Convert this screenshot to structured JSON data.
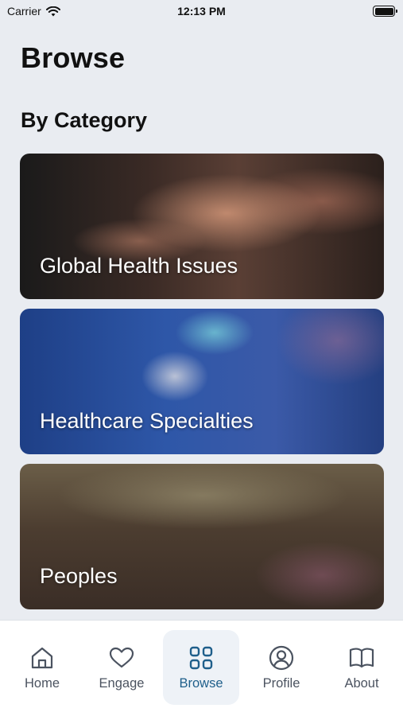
{
  "status_bar": {
    "carrier": "Carrier",
    "time": "12:13 PM"
  },
  "page_title": "Browse",
  "section_title": "By Category",
  "categories": [
    {
      "label": "Global Health Issues"
    },
    {
      "label": "Healthcare Specialties"
    },
    {
      "label": "Peoples"
    }
  ],
  "tab_bar": {
    "tabs": [
      {
        "label": "Home",
        "icon": "house-icon",
        "active": false
      },
      {
        "label": "Engage",
        "icon": "heart-icon",
        "active": false
      },
      {
        "label": "Browse",
        "icon": "grid-icon",
        "active": true
      },
      {
        "label": "Profile",
        "icon": "user-circle-icon",
        "active": false
      },
      {
        "label": "About",
        "icon": "book-icon",
        "active": false
      }
    ]
  },
  "colors": {
    "background": "#e9ecf1",
    "active_tab": "#1f5f8b",
    "inactive_tab": "#4b5360"
  }
}
